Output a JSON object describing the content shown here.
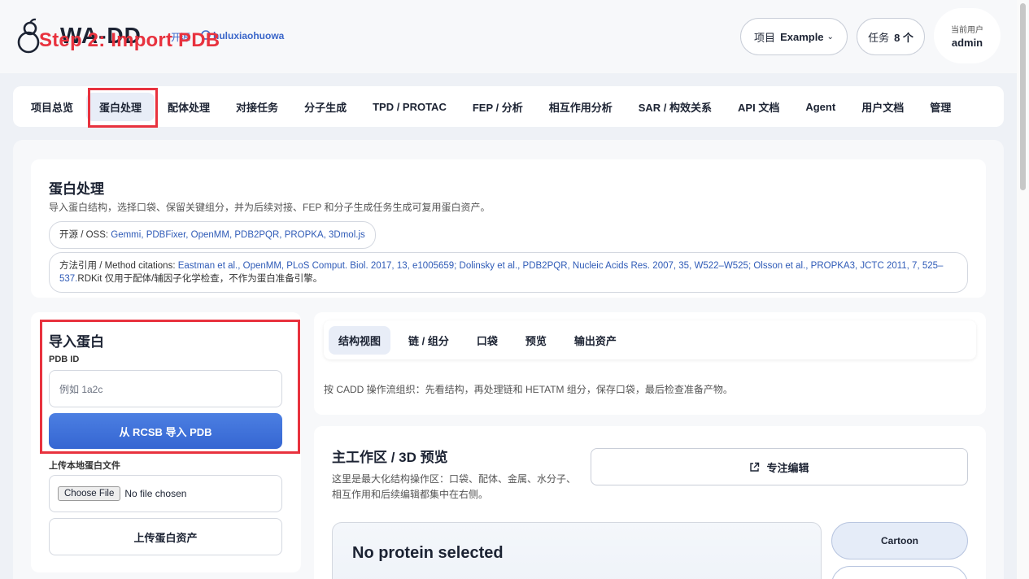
{
  "header": {
    "logo_text": "WA-DD",
    "logo_sub": "开源",
    "github_user": "huluxiaohuowa",
    "step_annotation": "Step 2: Import PDB",
    "project_label": "项目",
    "project_value": "Example",
    "tasks_label": "任务",
    "tasks_value": "8 个",
    "user_label": "当前用户",
    "user_name": "admin"
  },
  "nav": {
    "items": [
      "项目总览",
      "蛋白处理",
      "配体处理",
      "对接任务",
      "分子生成",
      "TPD / PROTAC",
      "FEP / 分析",
      "相互作用分析",
      "SAR / 构效关系",
      "API 文档",
      "Agent",
      "用户文档",
      "管理"
    ],
    "active": "蛋白处理"
  },
  "intro": {
    "title": "蛋白处理",
    "desc": "导入蛋白结构，选择口袋、保留关键组分，并为后续对接、FEP 和分子生成任务生成可复用蛋白资产。",
    "oss_prefix": "开源 / OSS: ",
    "oss_links": "Gemmi, PDBFixer, OpenMM, PDB2PQR, PROPKA, 3Dmol.js",
    "cite_prefix": "方法引用 / Method citations: ",
    "cite_links": "Eastman et al., OpenMM, PLoS Comput. Biol. 2017, 13, e1005659; Dolinsky et al., PDB2PQR, Nucleic Acids Res. 2007, 35, W522–W525; Olsson et al., PROPKA3, JCTC 2011, 7, 525–537.",
    "cite_suffix": "RDKit 仅用于配体/辅因子化学检查，不作为蛋白准备引擎。"
  },
  "import": {
    "title": "导入蛋白",
    "pdb_label": "PDB ID",
    "pdb_placeholder": "例如 1a2c",
    "import_button": "从 RCSB 导入 PDB",
    "upload_label": "上传本地蛋白文件",
    "choose_file": "Choose File",
    "no_file": "No file chosen",
    "upload_button": "上传蛋白资产"
  },
  "tabs": {
    "items": [
      "结构视图",
      "链 / 组分",
      "口袋",
      "预览",
      "输出资产"
    ],
    "active": "结构视图",
    "desc": "按 CADD 操作流组织：先看结构，再处理链和 HETATM 组分，保存口袋，最后检查准备产物。"
  },
  "workspace": {
    "title": "主工作区 / 3D 预览",
    "desc": "这里是最大化结构操作区：口袋、配体、金属、水分子、相互作用和后续编辑都集中在右侧。",
    "focus_button": "专注编辑",
    "viewer_title": "No protein selected",
    "style_buttons": [
      "Cartoon",
      ""
    ]
  },
  "colors": {
    "accent": "#3566d2",
    "annotation": "#e8323e",
    "link": "#2f5bb7"
  }
}
